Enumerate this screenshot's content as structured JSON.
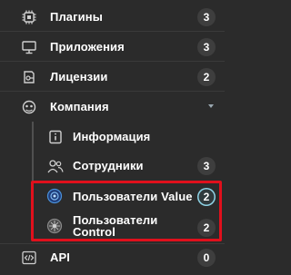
{
  "menu": {
    "plugins": {
      "label": "Плагины",
      "count": "3",
      "icon": "chip-icon"
    },
    "apps": {
      "label": "Приложения",
      "count": "3",
      "icon": "monitor-icon"
    },
    "licenses": {
      "label": "Лицензии",
      "count": "2",
      "icon": "license-icon"
    },
    "company": {
      "label": "Компания",
      "icon": "company-icon",
      "expanded": true
    },
    "company_children": {
      "info": {
        "label": "Информация",
        "icon": "info-icon"
      },
      "employees": {
        "label": "Сотрудники",
        "count": "3",
        "icon": "users-icon"
      },
      "users_value": {
        "label": "Пользователи Value",
        "count": "2",
        "icon": "value-logo-icon"
      },
      "users_control": {
        "label_line1": "Пользователи",
        "label_line2": "Control",
        "count": "2",
        "icon": "control-logo-icon"
      }
    },
    "api": {
      "label": "API",
      "count": "0",
      "icon": "code-icon"
    }
  },
  "colors": {
    "background": "#2b2b2b",
    "badge": "#3e3e3e",
    "highlight": "#e0101c",
    "accent_ring": "#8fd3e6"
  }
}
